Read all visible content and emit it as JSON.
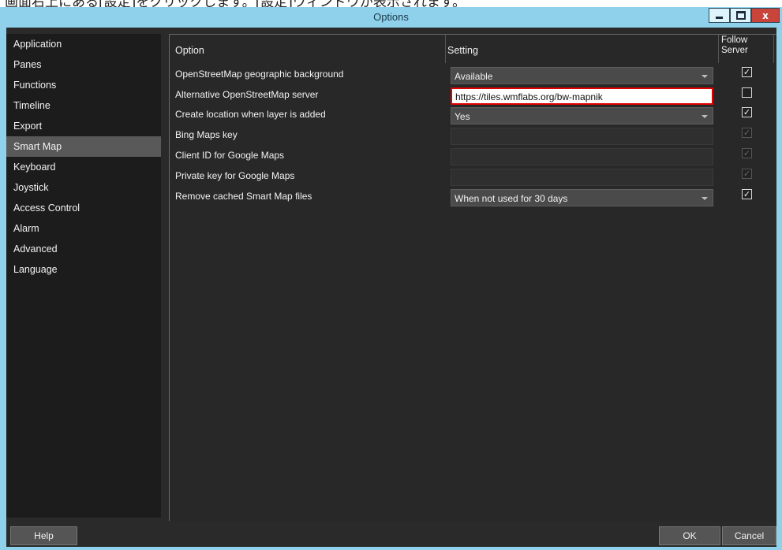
{
  "caption": "画面右上にある[設定]をクリックします。[設定]ウィンドウが表示されます。",
  "window": {
    "title": "Options",
    "close_label": "x"
  },
  "sidebar": {
    "items": [
      {
        "label": "Application"
      },
      {
        "label": "Panes"
      },
      {
        "label": "Functions"
      },
      {
        "label": "Timeline"
      },
      {
        "label": "Export"
      },
      {
        "label": "Smart Map",
        "selected": true
      },
      {
        "label": "Keyboard"
      },
      {
        "label": "Joystick"
      },
      {
        "label": "Access Control"
      },
      {
        "label": "Alarm"
      },
      {
        "label": "Advanced"
      },
      {
        "label": "Language"
      }
    ]
  },
  "grid": {
    "headers": {
      "option": "Option",
      "setting": "Setting",
      "follow_line1": "Follow",
      "follow_line2": "Server"
    },
    "rows": [
      {
        "label": "OpenStreetMap geographic background",
        "type": "dropdown",
        "value": "Available",
        "follow": "checked"
      },
      {
        "label": "Alternative OpenStreetMap server",
        "type": "text",
        "value": "https://tiles.wmflabs.org/bw-mapnik",
        "follow": "unchecked"
      },
      {
        "label": "Create location when layer is added",
        "type": "dropdown",
        "value": "Yes",
        "follow": "checked"
      },
      {
        "label": "Bing Maps key",
        "type": "empty",
        "value": "",
        "follow": "checked-disabled"
      },
      {
        "label": "Client ID for Google Maps",
        "type": "empty",
        "value": "",
        "follow": "checked-disabled"
      },
      {
        "label": "Private key for Google Maps",
        "type": "empty",
        "value": "",
        "follow": "checked-disabled"
      },
      {
        "label": "Remove cached Smart Map files",
        "type": "dropdown",
        "value": "When not used for 30 days",
        "follow": "checked"
      }
    ]
  },
  "footer": {
    "help_label": "Help",
    "ok_label": "OK",
    "cancel_label": "Cancel"
  },
  "colors": {
    "accent_highlight": "#e00000",
    "titlebar": "#8fd1ea",
    "selected_nav": "#595959"
  }
}
